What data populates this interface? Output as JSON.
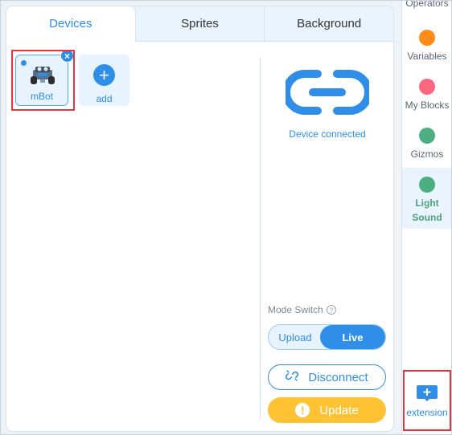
{
  "tabs": {
    "devices": "Devices",
    "sprites": "Sprites",
    "background": "Background"
  },
  "devices_panel": {
    "device_label": "mBot",
    "add_label": "add",
    "close_glyph": "×",
    "add_glyph": "+"
  },
  "status": {
    "connected_text": "Device connected",
    "mode_switch_label": "Mode Switch",
    "help_glyph": "?",
    "upload_label": "Upload",
    "live_label": "Live",
    "disconnect_label": "Disconnect",
    "update_label": "Update",
    "update_glyph": "!"
  },
  "categories": {
    "operators_label": "Operators",
    "variables_label": "Variables",
    "myblocks_label": "My Blocks",
    "gizmos_label": "Gizmos",
    "lightsound_label_line1": "Light",
    "lightsound_label_line2": "Sound",
    "extension_label": "extension"
  },
  "colors": {
    "accent": "#2e8ee8",
    "variables": "#ff8c1a",
    "myblocks": "#ff6680",
    "gizmos": "#4caf82",
    "lightsound": "#4caf82",
    "update": "#ffc233",
    "highlight": "#e6343f"
  },
  "icons": {
    "device_thumb": "mbot-robot-icon",
    "connect": "link-icon",
    "disconnect": "unlink-icon",
    "extension": "extension-plus-icon"
  }
}
